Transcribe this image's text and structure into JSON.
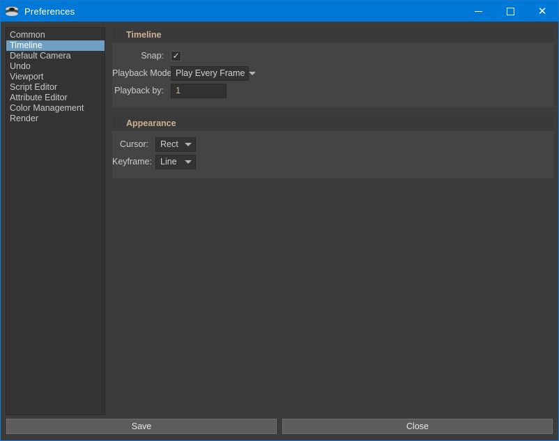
{
  "window": {
    "title": "Preferences",
    "icon": "maya-layers-icon",
    "controls": {
      "minimize": "minimize-icon",
      "maximize": "maximize-icon",
      "close": "close-icon",
      "close_glyph": "✕"
    },
    "accent_color": "#0078d7",
    "border_color": "#1979d2"
  },
  "sidebar": {
    "selected": "Timeline",
    "selection_color": "#6f9fc4",
    "items": [
      {
        "label": "Common"
      },
      {
        "label": "Timeline"
      },
      {
        "label": "Default Camera"
      },
      {
        "label": "Undo"
      },
      {
        "label": "Viewport"
      },
      {
        "label": "Script Editor"
      },
      {
        "label": "Attribute Editor"
      },
      {
        "label": "Color Management"
      },
      {
        "label": "Render"
      }
    ]
  },
  "groups": [
    {
      "title": "Timeline",
      "rows": [
        {
          "label": "Snap:",
          "type": "checkbox",
          "checked": true,
          "check_glyph": "✓"
        },
        {
          "label": "Playback Mode:",
          "type": "dropdown",
          "value": "Play Every Frame"
        },
        {
          "label": "Playback by:",
          "type": "text",
          "value": "1"
        }
      ]
    },
    {
      "title": "Appearance",
      "rows": [
        {
          "label": "Cursor:",
          "type": "dropdown",
          "value": "Rect"
        },
        {
          "label": "Keyframe:",
          "type": "dropdown",
          "value": "Line"
        }
      ]
    }
  ],
  "footer": {
    "save_label": "Save",
    "close_label": "Close"
  },
  "colors": {
    "header_text": "#cbb392",
    "panel_bg": "#444444",
    "group_header_bg": "#3a3a3a",
    "window_bg": "#3c3c3c"
  }
}
